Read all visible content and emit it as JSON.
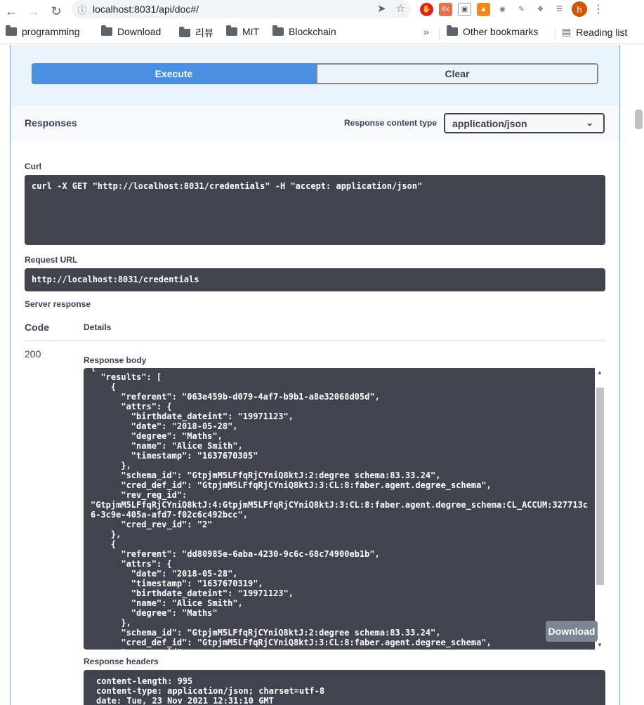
{
  "browser": {
    "url": "localhost:8031/api/doc#/",
    "profile_initial": "h",
    "bookmarks": [
      "programming",
      "Download",
      "리뷰",
      "MIT",
      "Blockchain"
    ],
    "more_label": "»",
    "other_bookmarks": "Other bookmarks",
    "reading_list": "Reading list"
  },
  "actions": {
    "execute_label": "Execute",
    "clear_label": "Clear"
  },
  "responses": {
    "title": "Responses",
    "content_type_label": "Response content type",
    "content_type_value": "application/json"
  },
  "curl": {
    "label": "Curl",
    "command": "curl -X GET \"http://localhost:8031/credentials\" -H \"accept: application/json\""
  },
  "request_url": {
    "label": "Request URL",
    "value": "http://localhost:8031/credentials"
  },
  "server_response": {
    "label": "Server response",
    "code_header": "Code",
    "details_header": "Details",
    "code": "200",
    "body_label": "Response body",
    "body": "{\n  \"results\": [\n    {\n      \"referent\": \"063e459b-d079-4af7-b9b1-a8e32068d05d\",\n      \"attrs\": {\n        \"birthdate_dateint\": \"19971123\",\n        \"date\": \"2018-05-28\",\n        \"degree\": \"Maths\",\n        \"name\": \"Alice Smith\",\n        \"timestamp\": \"1637670305\"\n      },\n      \"schema_id\": \"GtpjmM5LFfqRjCYniQ8ktJ:2:degree schema:83.33.24\",\n      \"cred_def_id\": \"GtpjmM5LFfqRjCYniQ8ktJ:3:CL:8:faber.agent.degree_schema\",\n      \"rev_reg_id\":\n\"GtpjmM5LFfqRjCYniQ8ktJ:4:GtpjmM5LFfqRjCYniQ8ktJ:3:CL:8:faber.agent.degree_schema:CL_ACCUM:327713c\n6-3c9e-405a-afd7-f02c6c492bcc\",\n      \"cred_rev_id\": \"2\"\n    },\n    {\n      \"referent\": \"dd80985e-6aba-4230-9c6c-68c74900eb1b\",\n      \"attrs\": {\n        \"date\": \"2018-05-28\",\n        \"timestamp\": \"1637670319\",\n        \"birthdate_dateint\": \"19971123\",\n        \"name\": \"Alice Smith\",\n        \"degree\": \"Maths\"\n      },\n      \"schema_id\": \"GtpjmM5LFfqRjCYniQ8ktJ:2:degree schema:83.33.24\",\n      \"cred_def_id\": \"GtpjmM5LFfqRjCYniQ8ktJ:3:CL:8:faber.agent.degree_schema\",\n      \"rev_reg_id\":",
    "download_label": "Download",
    "headers_label": "Response headers",
    "headers": "content-length: 995\ncontent-type: application/json; charset=utf-8\ndate: Tue, 23 Nov 2021 12:31:10 GMT"
  }
}
